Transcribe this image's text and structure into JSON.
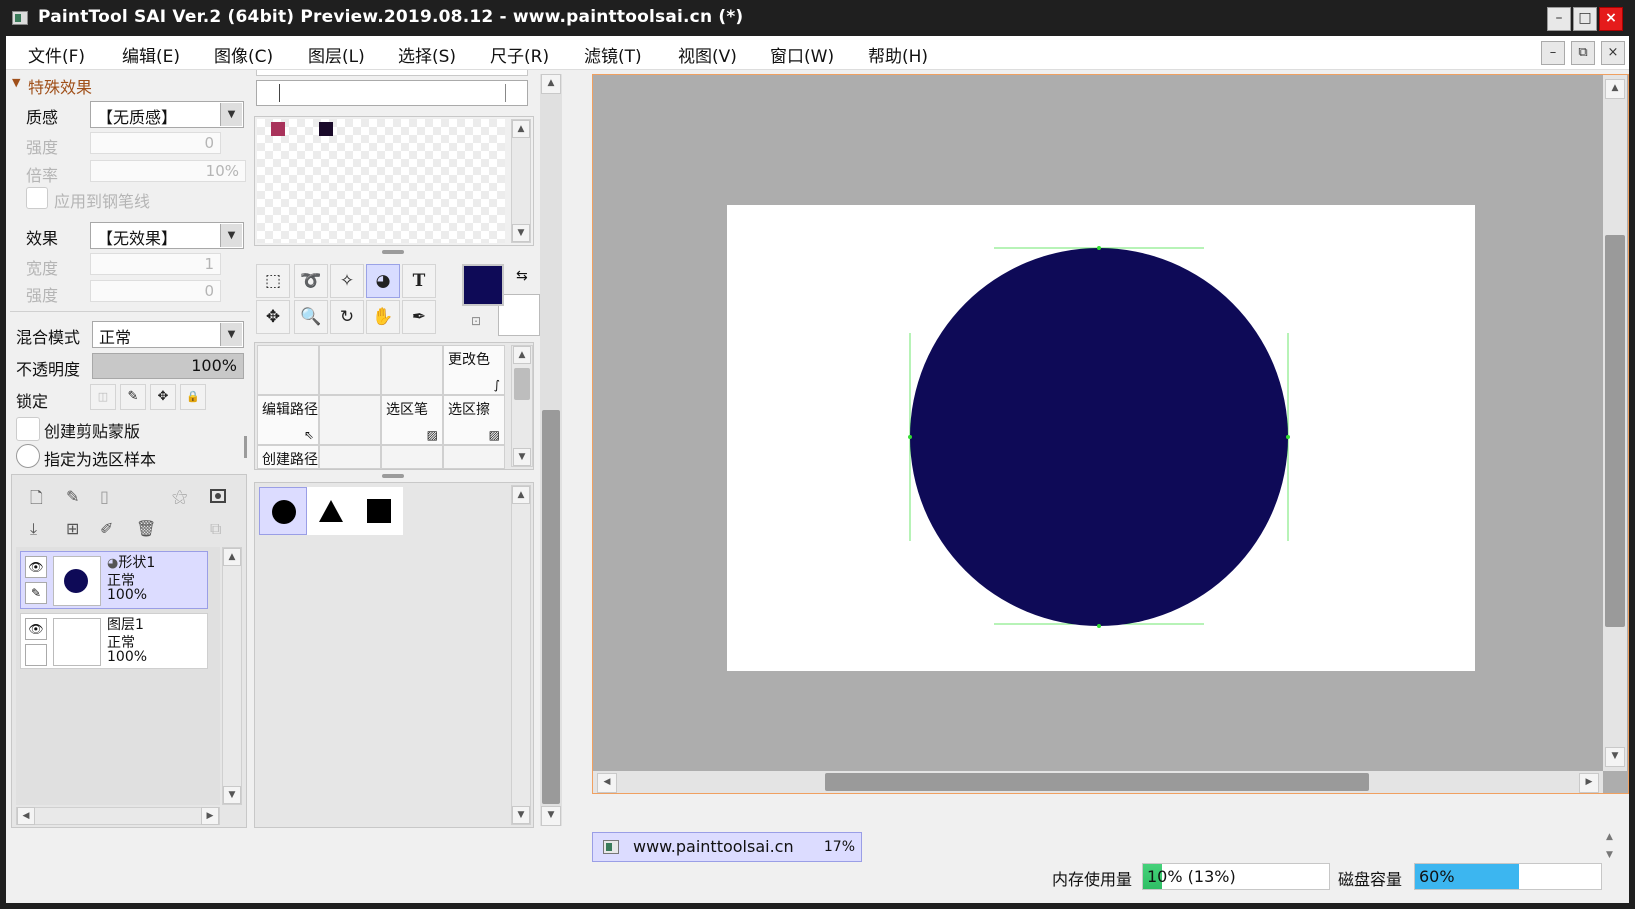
{
  "window": {
    "title": "PaintTool SAI Ver.2 (64bit) Preview.2019.08.12 - www.painttoolsai.cn (*)",
    "minimize": "–",
    "maximize": "□",
    "close": "×"
  },
  "menu": [
    "文件(F)",
    "编辑(E)",
    "图像(C)",
    "图层(L)",
    "选择(S)",
    "尺子(R)",
    "滤镜(T)",
    "视图(V)",
    "窗口(W)",
    "帮助(H)"
  ],
  "mdi": {
    "minimize": "–",
    "restore": "⧉",
    "close": "×"
  },
  "effects": {
    "header": "特殊效果",
    "texture_label": "质感",
    "texture_value": "【无质感】",
    "strength_label": "强度",
    "strength_value": "0",
    "scale_label": "倍率",
    "scale_value": "10%",
    "apply_pen_label": "应用到钢笔线",
    "effect_label": "效果",
    "effect_value": "【无效果】",
    "width_label": "宽度",
    "width_value": "1",
    "strength2_label": "强度",
    "strength2_value": "0"
  },
  "layer_props": {
    "blend_label": "混合模式",
    "blend_value": "正常",
    "opacity_label": "不透明度",
    "opacity_value": "100%",
    "opacity_fraction": 1.0,
    "lock_label": "锁定",
    "clip_label": "创建剪贴蒙版",
    "selection_sample_label": "指定为选区样本"
  },
  "layers": [
    {
      "name": "形状1",
      "mode": "正常",
      "opacity": "100%",
      "selected": true,
      "has_circle": true
    },
    {
      "name": "图层1",
      "mode": "正常",
      "opacity": "100%",
      "selected": false,
      "has_circle": false
    }
  ],
  "swatches": {
    "color1": "#a8325a",
    "color2": "#1a0a2a"
  },
  "colors": {
    "primary": "#0e0a57",
    "secondary": "#ffffff",
    "accent_selection": "#d8dcff",
    "guide": "#33dd33"
  },
  "tool_cells": {
    "change_color": "更改色",
    "edit_path": "编辑路径",
    "select_pen": "选区笔",
    "select_eraser": "选区擦",
    "create_path": "创建路径"
  },
  "shapes": [
    "circle",
    "triangle",
    "square"
  ],
  "document": {
    "tab_name": "www.painttoolsai.cn",
    "zoom": "17%"
  },
  "status": {
    "memory_label": "内存使用量",
    "memory_value": "10% (13%)",
    "memory_fraction": 0.1,
    "disk_label": "磁盘容量",
    "disk_value": "60%",
    "disk_fraction": 0.6
  }
}
